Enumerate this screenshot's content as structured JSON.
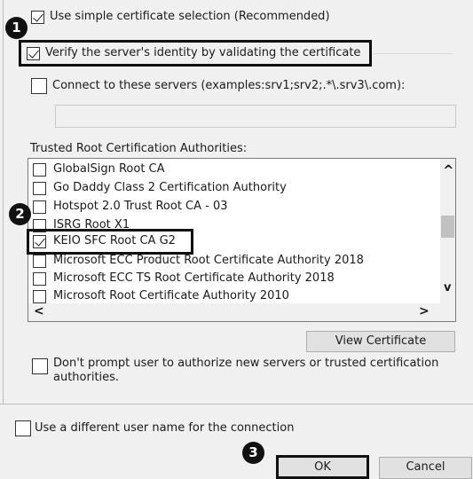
{
  "options": {
    "simple_selection": {
      "label": "Use simple certificate selection (Recommended)",
      "checked": true
    },
    "verify_identity": {
      "label": "Verify the server's identity by validating the certificate",
      "checked": true
    },
    "connect_servers": {
      "label": "Connect to these servers (examples:srv1;srv2;.*\\.srv3\\.com):",
      "checked": false,
      "value": ""
    },
    "dont_prompt": {
      "label": "Don't prompt user to authorize new servers or trusted certification authorities.",
      "checked": false
    },
    "different_user": {
      "label": "Use a different user name for the connection",
      "checked": false
    }
  },
  "trusted_root": {
    "heading": "Trusted Root Certification Authorities:",
    "items": [
      {
        "label": "GlobalSign Root CA",
        "checked": false
      },
      {
        "label": "Go Daddy Class 2 Certification Authority",
        "checked": false
      },
      {
        "label": "Hotspot 2.0 Trust Root CA - 03",
        "checked": false
      },
      {
        "label": "ISRG Root X1",
        "checked": false
      },
      {
        "label": "KEIO SFC Root CA G2",
        "checked": true
      },
      {
        "label": "Microsoft ECC Product Root Certificate Authority 2018",
        "checked": false
      },
      {
        "label": "Microsoft ECC TS Root Certificate Authority 2018",
        "checked": false
      },
      {
        "label": "Microsoft Root Certificate Authority 2010",
        "checked": false
      }
    ]
  },
  "buttons": {
    "view_certificate": "View Certificate",
    "ok": "OK",
    "cancel": "Cancel"
  },
  "callouts": {
    "one": "1",
    "two": "2",
    "three": "3"
  },
  "scroll_glyphs": {
    "up": "^",
    "down": "v",
    "left": "<",
    "right": ">"
  }
}
